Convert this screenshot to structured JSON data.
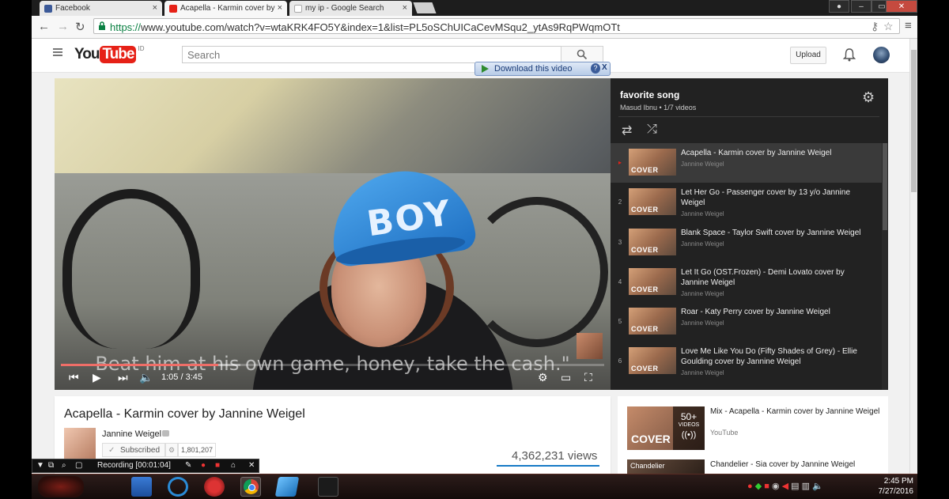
{
  "tabs": [
    {
      "title": "Facebook",
      "color": "#3b5998",
      "icon": "facebook-icon"
    },
    {
      "title": "Acapella - Karmin cover by",
      "color": "#e62117",
      "icon": "youtube-icon"
    },
    {
      "title": "my ip - Google Search",
      "color": "#4285f4",
      "icon": "google-icon"
    }
  ],
  "address": {
    "scheme": "https://",
    "rest": "www.youtube.com/watch?v=wtaKRK4FO5Y&index=1&list=PL5oSChUICaCevMSqu2_ytAs9RqPWqmOTt"
  },
  "youtube": {
    "logo_you": "You",
    "logo_tube": "Tube",
    "logo_region": "ID",
    "search_placeholder": "Search",
    "upload_label": "Upload"
  },
  "download_plugin": {
    "label": "Download this video",
    "help": "?",
    "close": "X"
  },
  "player": {
    "subtitle": "Beat him at his own game, honey, take the cash.\"",
    "cap_text": "BOY",
    "time": "1:05 / 3:45",
    "progress": 0.29
  },
  "playlist": {
    "title": "favorite song",
    "owner_line": "Masud Ibnu • 1/7 videos",
    "items": [
      {
        "num": "▸",
        "title": "Acapella - Karmin cover by Jannine Weigel",
        "author": "Jannine Weigel"
      },
      {
        "num": "2",
        "title": "Let Her Go - Passenger cover by 13 y/o Jannine Weigel",
        "author": "Jannine Weigel"
      },
      {
        "num": "3",
        "title": "Blank Space - Taylor Swift cover by Jannine Weigel",
        "author": "Jannine Weigel"
      },
      {
        "num": "4",
        "title": "Let It Go (OST.Frozen) - Demi Lovato cover by Jannine Weigel",
        "author": "Jannine Weigel"
      },
      {
        "num": "5",
        "title": "Roar - Katy Perry cover by Jannine Weigel",
        "author": "Jannine Weigel"
      },
      {
        "num": "6",
        "title": "Love Me Like You Do (Fifty Shades of Grey) - Ellie Goulding cover by Jannine Weigel",
        "author": "Jannine Weigel"
      }
    ]
  },
  "info": {
    "title": "Acapella - Karmin cover by Jannine Weigel",
    "channel": "Jannine Weigel",
    "subscribe_label": "Subscribed",
    "subscriber_count": "1,801,207",
    "views": "4,362,231 views"
  },
  "sidebar": {
    "mix_title": "Mix - Acapella - Karmin cover by Jannine Weigel",
    "mix_by": "YouTube",
    "mix_count": "50+",
    "mix_count_label": "VIDEOS",
    "next_title": "Chandelier - Sia cover by Jannine Weigel"
  },
  "recording": {
    "label": "Recording [00:01:04]"
  },
  "clock": {
    "time": "2:45 PM",
    "date": "7/27/2016"
  }
}
